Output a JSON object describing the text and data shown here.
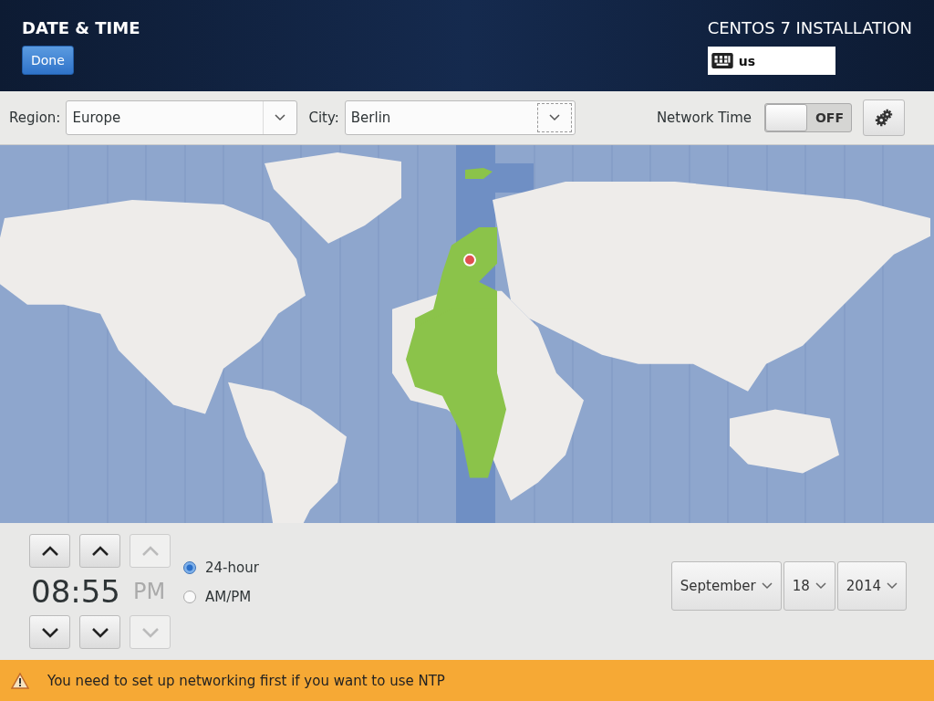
{
  "header": {
    "title": "DATE & TIME",
    "done_button": "Done",
    "product": "CENTOS 7 INSTALLATION",
    "keyboard_layout": "us"
  },
  "toolbar": {
    "region_label": "Region:",
    "region_value": "Europe",
    "city_label": "City:",
    "city_value": "Berlin",
    "network_time_label": "Network Time",
    "network_time": {
      "on": false,
      "label": "OFF"
    }
  },
  "time": {
    "value": "08:55",
    "period": "PM",
    "period_disabled": true,
    "spinners": [
      {
        "disabled": false
      },
      {
        "disabled": false
      },
      {
        "disabled": true
      }
    ],
    "formats": [
      {
        "label": "24-hour",
        "selected": true
      },
      {
        "label": "AM/PM",
        "selected": false
      }
    ]
  },
  "date": {
    "month": "September",
    "day": "18",
    "year": "2014"
  },
  "warning": {
    "text": "You need to set up networking first if you want to use NTP"
  }
}
